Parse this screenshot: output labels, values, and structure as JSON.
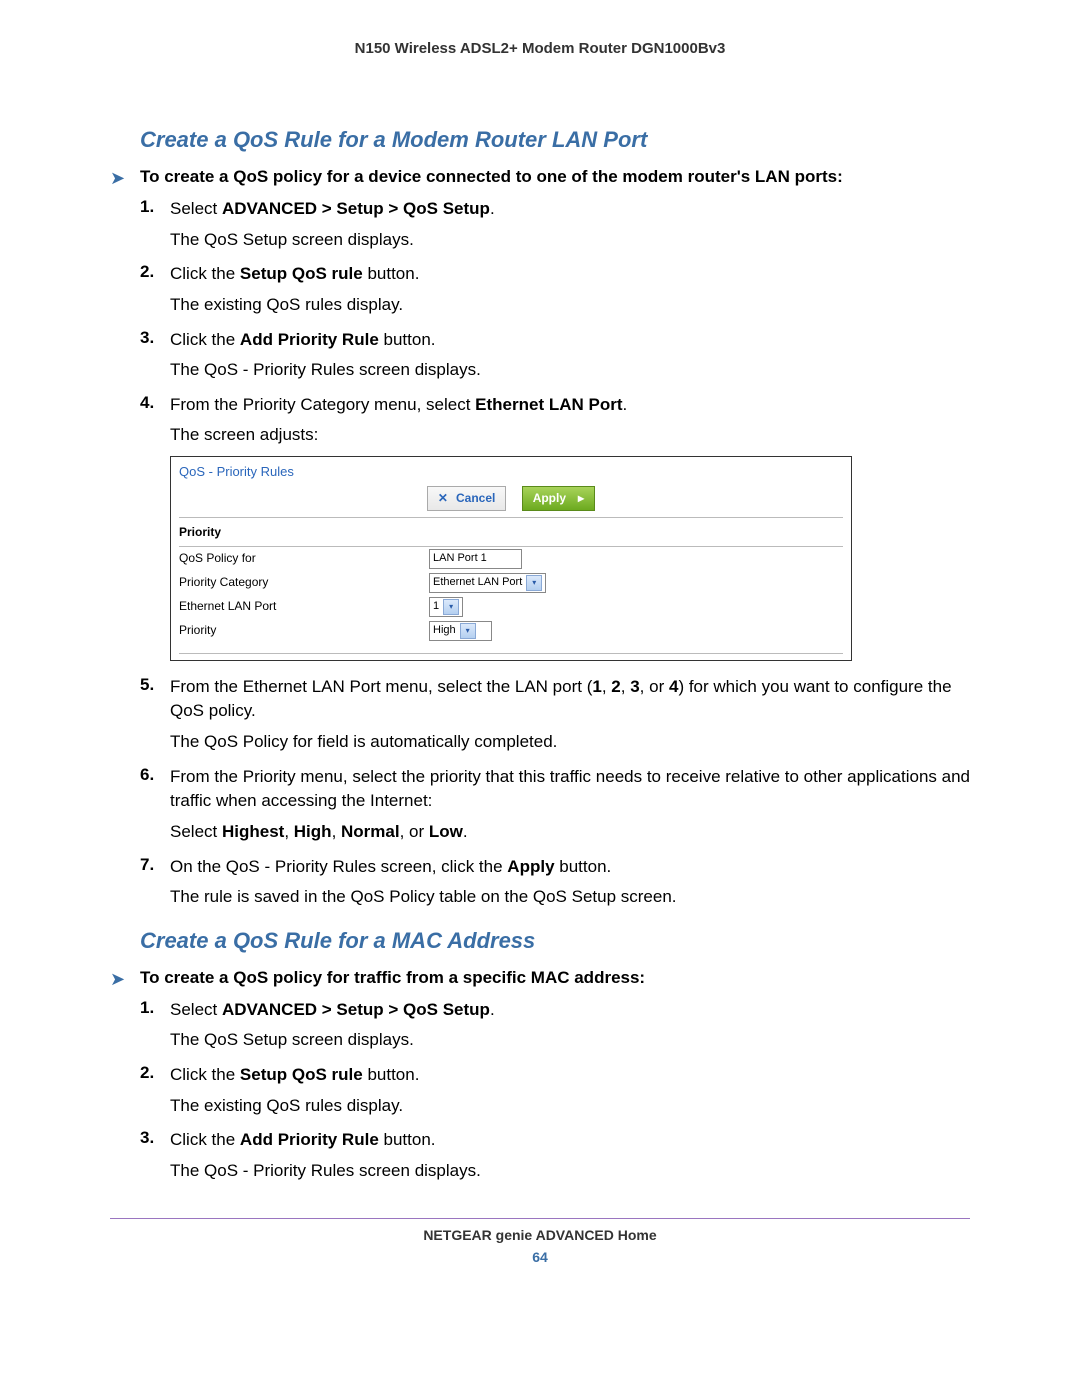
{
  "doc": {
    "header": "N150 Wireless ADSL2+ Modem Router DGN1000Bv3",
    "footer": "NETGEAR genie ADVANCED Home",
    "page_number": "64"
  },
  "section1": {
    "title": "Create a QoS Rule for a Modem Router LAN Port",
    "procedure_intro": "To create a QoS policy for a device connected to one of the modem router's LAN ports:",
    "arrow": "➤",
    "steps": [
      {
        "num": "1.",
        "line1_pre": "Select ",
        "line1_bold": "ADVANCED > Setup > QoS Setup",
        "line1_post": ".",
        "line2": "The QoS Setup screen displays."
      },
      {
        "num": "2.",
        "line1_pre": "Click the ",
        "line1_bold": "Setup QoS rule",
        "line1_post": " button.",
        "line2": "The existing QoS rules display."
      },
      {
        "num": "3.",
        "line1_pre": "Click the ",
        "line1_bold": "Add Priority Rule",
        "line1_post": " button.",
        "line2": "The QoS - Priority Rules screen displays."
      },
      {
        "num": "4.",
        "line1_pre": "From the Priority Category menu, select ",
        "line1_bold": "Ethernet LAN Port",
        "line1_post": ".",
        "line2": "The screen adjusts:"
      },
      {
        "num": "5.",
        "html": "From the Ethernet LAN Port menu, select the LAN port (<b>1</b>, <b>2</b>, <b>3</b>, or <b>4</b>) for which you want to configure the QoS policy.",
        "line2": "The QoS Policy for field is automatically completed."
      },
      {
        "num": "6.",
        "line1": "From the Priority menu, select the priority that this traffic needs to receive relative to other applications and traffic when accessing the Internet:",
        "line2_html": "Select <b>Highest</b>, <b>High</b>, <b>Normal</b>, or <b>Low</b>."
      },
      {
        "num": "7.",
        "html": "On the QoS - Priority Rules screen, click the <b>Apply</b> button.",
        "line2": "The rule is saved in the QoS Policy table on the QoS Setup screen."
      }
    ]
  },
  "ui_screenshot": {
    "title": "QoS - Priority Rules",
    "cancel_label": "Cancel",
    "apply_label": "Apply",
    "section_label": "Priority",
    "rows": {
      "policy_for_label": "QoS Policy for",
      "policy_for_value": "LAN Port 1",
      "category_label": "Priority Category",
      "category_value": "Ethernet LAN Port",
      "lanport_label": "Ethernet LAN Port",
      "lanport_value": "1",
      "priority_label": "Priority",
      "priority_value": "High"
    }
  },
  "section2": {
    "title": "Create a QoS Rule for a MAC Address",
    "procedure_intro": "To create a QoS policy for traffic from a specific MAC address:",
    "arrow": "➤",
    "steps": [
      {
        "num": "1.",
        "line1_pre": "Select ",
        "line1_bold": "ADVANCED > Setup > QoS Setup",
        "line1_post": ".",
        "line2": "The QoS Setup screen displays."
      },
      {
        "num": "2.",
        "line1_pre": "Click the ",
        "line1_bold": "Setup QoS rule",
        "line1_post": " button.",
        "line2": "The existing QoS rules display."
      },
      {
        "num": "3.",
        "line1_pre": "Click the ",
        "line1_bold": "Add Priority Rule",
        "line1_post": " button.",
        "line2": "The QoS - Priority Rules screen displays."
      }
    ]
  }
}
